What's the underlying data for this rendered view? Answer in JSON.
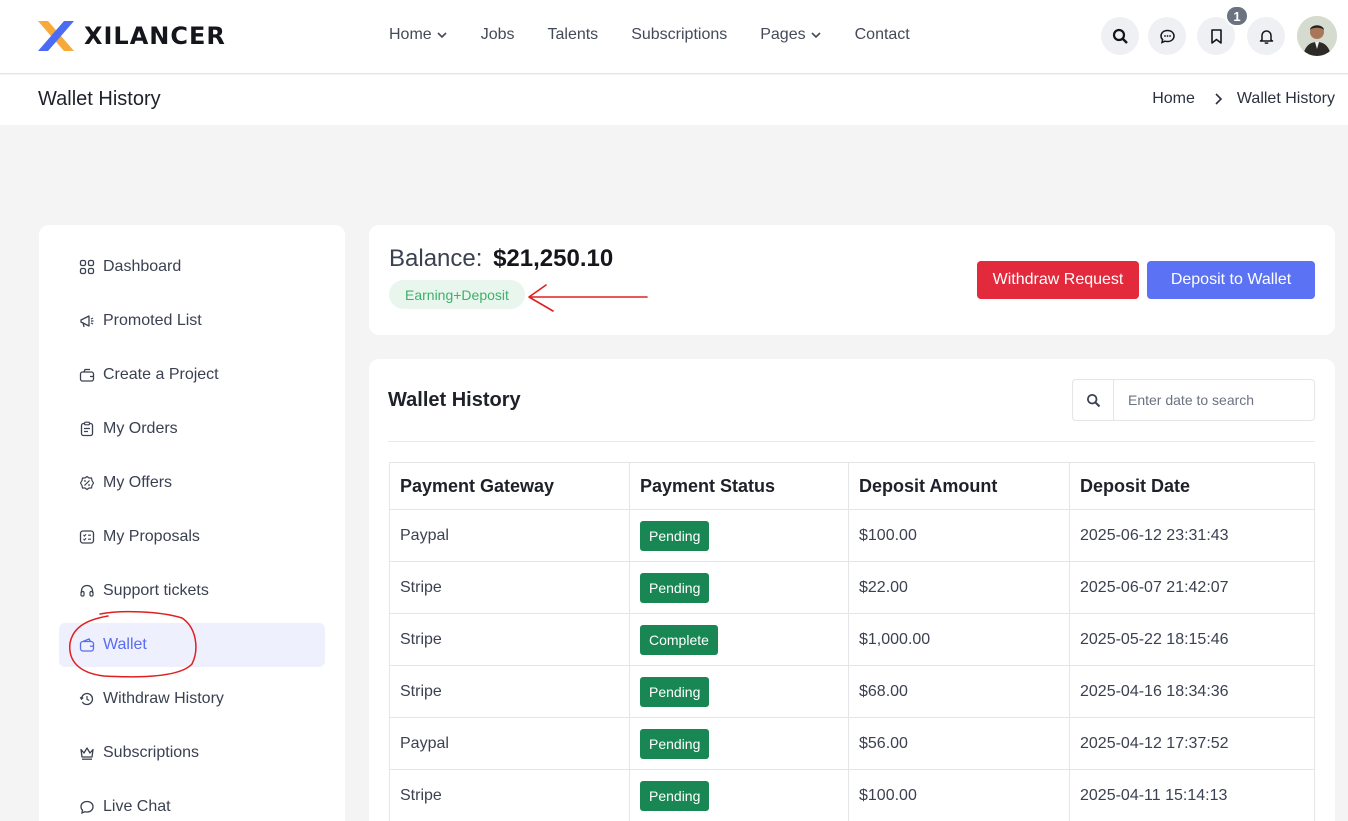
{
  "brand": {
    "name": "XILANCER"
  },
  "nav": {
    "items": [
      {
        "label": "Home",
        "dropdown": true
      },
      {
        "label": "Jobs",
        "dropdown": false
      },
      {
        "label": "Talents",
        "dropdown": false
      },
      {
        "label": "Subscriptions",
        "dropdown": false
      },
      {
        "label": "Pages",
        "dropdown": true
      },
      {
        "label": "Contact",
        "dropdown": false
      }
    ],
    "bookmark_count": "1",
    "icons": [
      "search-icon",
      "chat-icon",
      "bookmark-icon",
      "bell-icon",
      "avatar"
    ]
  },
  "page": {
    "title": "Wallet History",
    "breadcrumb": [
      "Home",
      "Wallet History"
    ]
  },
  "sidebar": {
    "items": [
      {
        "label": "Dashboard",
        "icon": "dashboard-icon",
        "active": false
      },
      {
        "label": "Promoted List",
        "icon": "megaphone-icon",
        "active": false
      },
      {
        "label": "Create a Project",
        "icon": "briefcase-icon",
        "active": false
      },
      {
        "label": "My Orders",
        "icon": "clipboard-icon",
        "active": false
      },
      {
        "label": "My Offers",
        "icon": "offer-badge-icon",
        "active": false
      },
      {
        "label": "My Proposals",
        "icon": "proposal-icon",
        "active": false
      },
      {
        "label": "Support tickets",
        "icon": "headset-icon",
        "active": false
      },
      {
        "label": "Wallet",
        "icon": "wallet-icon",
        "active": true
      },
      {
        "label": "Withdraw History",
        "icon": "history-icon",
        "active": false
      },
      {
        "label": "Subscriptions",
        "icon": "crown-icon",
        "active": false
      },
      {
        "label": "Live Chat",
        "icon": "chat-bubble-icon",
        "active": false
      }
    ]
  },
  "balance": {
    "label": "Balance:",
    "amount": "$21,250.10",
    "tag": "Earning+Deposit",
    "withdraw_label": "Withdraw Request",
    "deposit_label": "Deposit to Wallet"
  },
  "history": {
    "title": "Wallet History",
    "search_placeholder": "Enter date to search",
    "columns": [
      "Payment Gateway",
      "Payment Status",
      "Deposit Amount",
      "Deposit Date"
    ],
    "rows": [
      {
        "gateway": "Paypal",
        "status": "Pending",
        "amount": "$100.00",
        "date": "2025-06-12 23:31:43"
      },
      {
        "gateway": "Stripe",
        "status": "Pending",
        "amount": "$22.00",
        "date": "2025-06-07 21:42:07"
      },
      {
        "gateway": "Stripe",
        "status": "Complete",
        "amount": "$1,000.00",
        "date": "2025-05-22 18:15:46"
      },
      {
        "gateway": "Stripe",
        "status": "Pending",
        "amount": "$68.00",
        "date": "2025-04-16 18:34:36"
      },
      {
        "gateway": "Paypal",
        "status": "Pending",
        "amount": "$56.00",
        "date": "2025-04-12 17:37:52"
      },
      {
        "gateway": "Stripe",
        "status": "Pending",
        "amount": "$100.00",
        "date": "2025-04-11 15:14:13"
      }
    ]
  },
  "colors": {
    "accent": "#5a72f3",
    "danger": "#e22a3c",
    "status_badge": "#198754",
    "annotation": "#e02020"
  }
}
